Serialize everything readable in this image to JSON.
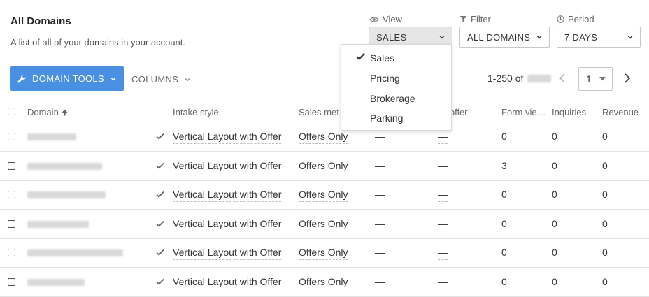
{
  "header": {
    "title": "All Domains",
    "subtitle": "A list of all of your domains in your account."
  },
  "controls": {
    "view": {
      "label": "View",
      "value": "SALES",
      "icon": "eye-icon"
    },
    "filter": {
      "label": "Filter",
      "value": "ALL DOMAINS",
      "icon": "funnel-icon"
    },
    "period": {
      "label": "Period",
      "value": "7 DAYS",
      "icon": "clock-icon"
    }
  },
  "view_menu": {
    "items": [
      {
        "label": "Sales",
        "selected": true
      },
      {
        "label": "Pricing",
        "selected": false
      },
      {
        "label": "Brokerage",
        "selected": false
      },
      {
        "label": "Parking",
        "selected": false
      }
    ]
  },
  "toolbar": {
    "domain_tools_label": "DOMAIN TOOLS",
    "columns_label": "COLUMNS"
  },
  "pagination": {
    "range_label": "1-250 of",
    "page": "1"
  },
  "table": {
    "columns": [
      "Domain",
      "Intake style",
      "Sales met",
      "n offer",
      "Form vie…",
      "Inquiries",
      "Revenue"
    ],
    "rows": [
      {
        "intake": "Vertical Layout with Offer",
        "sales": "Offers Only",
        "c4": "—",
        "c5": "—",
        "form_views": "0",
        "inquiries": "0",
        "revenue": "0"
      },
      {
        "intake": "Vertical Layout with Offer",
        "sales": "Offers Only",
        "c4": "—",
        "c5": "—",
        "form_views": "3",
        "inquiries": "0",
        "revenue": "0"
      },
      {
        "intake": "Vertical Layout with Offer",
        "sales": "Offers Only",
        "c4": "—",
        "c5": "—",
        "form_views": "0",
        "inquiries": "0",
        "revenue": "0"
      },
      {
        "intake": "Vertical Layout with Offer",
        "sales": "Offers Only",
        "c4": "—",
        "c5": "—",
        "form_views": "0",
        "inquiries": "0",
        "revenue": "0"
      },
      {
        "intake": "Vertical Layout with Offer",
        "sales": "Offers Only",
        "c4": "—",
        "c5": "—",
        "form_views": "0",
        "inquiries": "0",
        "revenue": "0"
      },
      {
        "intake": "Vertical Layout with Offer",
        "sales": "Offers Only",
        "c4": "—",
        "c5": "—",
        "form_views": "0",
        "inquiries": "0",
        "revenue": "0"
      }
    ]
  },
  "colors": {
    "primary": "#4a90e2",
    "border": "#c8c8c8",
    "text": "#333333"
  }
}
